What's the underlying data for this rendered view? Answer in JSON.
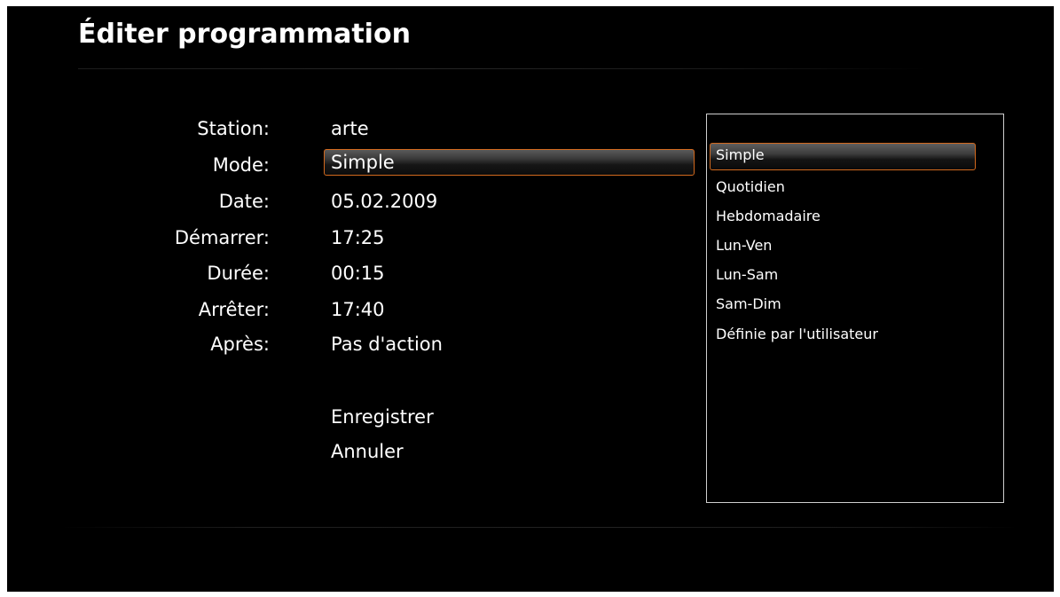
{
  "title": "Éditer programmation",
  "form": {
    "rows": [
      {
        "label": "Station:",
        "value": "arte"
      },
      {
        "label": "Mode:",
        "value": "Simple"
      },
      {
        "label": "Date:",
        "value": "05.02.2009"
      },
      {
        "label": "Démarrer:",
        "value": "17:25"
      },
      {
        "label": "Durée:",
        "value": "00:15"
      },
      {
        "label": "Arrêter:",
        "value": "17:40"
      },
      {
        "label": "Après:",
        "value": "Pas d'action"
      }
    ],
    "save_label": "Enregistrer",
    "cancel_label": "Annuler"
  },
  "mode_options": {
    "selected_index": 0,
    "items": [
      "Simple",
      "Quotidien",
      "Hebdomadaire",
      "Lun-Ven",
      "Lun-Sam",
      "Sam-Dim",
      "Définie par l'utilisateur"
    ]
  },
  "colors": {
    "background": "#000000",
    "text": "#ffffff",
    "focus_border": "#d2691e",
    "list_border": "#cfcfcf"
  }
}
